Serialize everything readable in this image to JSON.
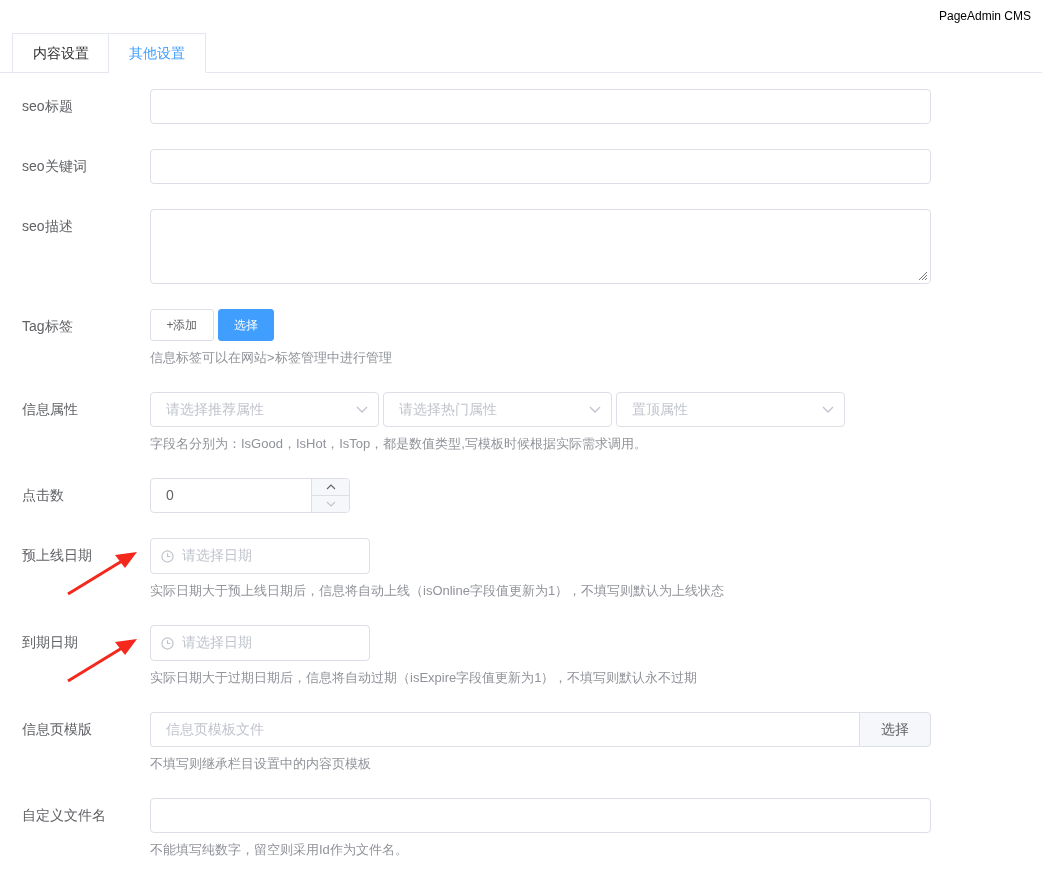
{
  "brand": "PageAdmin CMS",
  "tabs": [
    {
      "label": "内容设置",
      "selected": false
    },
    {
      "label": "其他设置",
      "selected": true
    }
  ],
  "fields": [
    {
      "kind": "text",
      "label": "seo标题"
    },
    {
      "kind": "text",
      "label": "seo关键词"
    },
    {
      "kind": "textarea",
      "label": "seo描述"
    },
    {
      "kind": "tags",
      "label": "Tag标签",
      "buttons": [
        {
          "label": "+添加",
          "kind": "plain"
        },
        {
          "label": "选择",
          "kind": "primary"
        }
      ],
      "hint": "信息标签可以在网站>标签管理中进行管理"
    },
    {
      "kind": "selects",
      "label": "信息属性",
      "selects": [
        {
          "placeholder": "请选择推荐属性"
        },
        {
          "placeholder": "请选择热门属性"
        },
        {
          "placeholder": "置顶属性"
        }
      ],
      "hint": "字段名分别为：IsGood，IsHot，IsTop，都是数值类型,写模板时候根据实际需求调用。"
    },
    {
      "kind": "number",
      "label": "点击数",
      "value": "0"
    },
    {
      "kind": "date",
      "label": "预上线日期",
      "placeholder": "请选择日期",
      "hint": "实际日期大于预上线日期后，信息将自动上线（isOnline字段值更新为1），不填写则默认为上线状态",
      "arrow": true
    },
    {
      "kind": "date",
      "label": "到期日期",
      "placeholder": "请选择日期",
      "hint": "实际日期大于过期日期后，信息将自动过期（isExpire字段值更新为1），不填写则默认永不过期",
      "arrow": true
    },
    {
      "kind": "file",
      "label": "信息页模版",
      "placeholder": "信息页模板文件",
      "button": "选择",
      "hint": "不填写则继承栏目设置中的内容页模板"
    },
    {
      "kind": "text",
      "label": "自定义文件名",
      "hint": "不能填写纯数字，留空则采用Id作为文件名。"
    }
  ]
}
